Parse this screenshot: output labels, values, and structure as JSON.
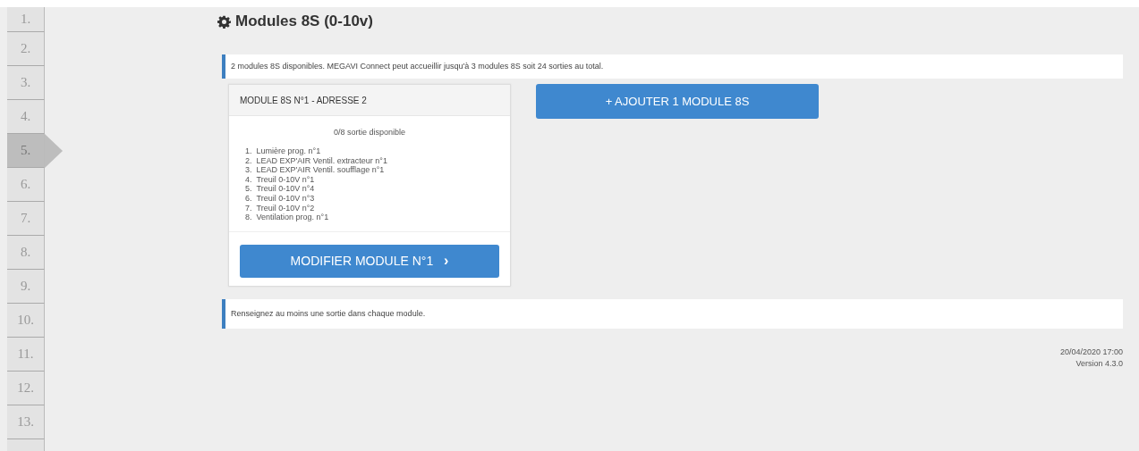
{
  "steps": [
    {
      "label": "1.",
      "selected": false
    },
    {
      "label": "2.",
      "selected": false
    },
    {
      "label": "3.",
      "selected": false
    },
    {
      "label": "4.",
      "selected": false
    },
    {
      "label": "5.",
      "selected": true
    },
    {
      "label": "6.",
      "selected": false
    },
    {
      "label": "7.",
      "selected": false
    },
    {
      "label": "8.",
      "selected": false
    },
    {
      "label": "9.",
      "selected": false
    },
    {
      "label": "10.",
      "selected": false
    },
    {
      "label": "11.",
      "selected": false
    },
    {
      "label": "12.",
      "selected": false
    },
    {
      "label": "13.",
      "selected": false
    }
  ],
  "title": "Modules 8S (0-10v)",
  "info": "2 modules 8S disponibles. MEGAVI Connect peut accueillir jusqu'à 3 modules 8S soit 24 sorties au total.",
  "modules": [
    {
      "header": "MODULE 8S N°1 - ADRESSE 2",
      "availability": "0/8 sortie disponible",
      "outputs": [
        {
          "number": "1.",
          "label": "Lumière prog. n°1"
        },
        {
          "number": "2.",
          "label": "LEAD EXP'AIR Ventil. extracteur n°1"
        },
        {
          "number": "3.",
          "label": "LEAD EXP'AIR Ventil. soufflage n°1"
        },
        {
          "number": "4.",
          "label": "Treuil 0-10V n°1"
        },
        {
          "number": "5.",
          "label": "Treuil 0-10V n°4"
        },
        {
          "number": "6.",
          "label": "Treuil 0-10V n°3"
        },
        {
          "number": "7.",
          "label": "Treuil 0-10V n°2"
        },
        {
          "number": "8.",
          "label": "Ventilation prog. n°1"
        }
      ],
      "button": "MODIFIER MODULE N°1",
      "button_icon": "›"
    }
  ],
  "add_button": "+ AJOUTER 1 MODULE 8S",
  "alert": "Renseignez au moins une sortie dans chaque module.",
  "footer": {
    "datetime": "20/04/2020 17:00",
    "version": "Version 4.3.0"
  }
}
